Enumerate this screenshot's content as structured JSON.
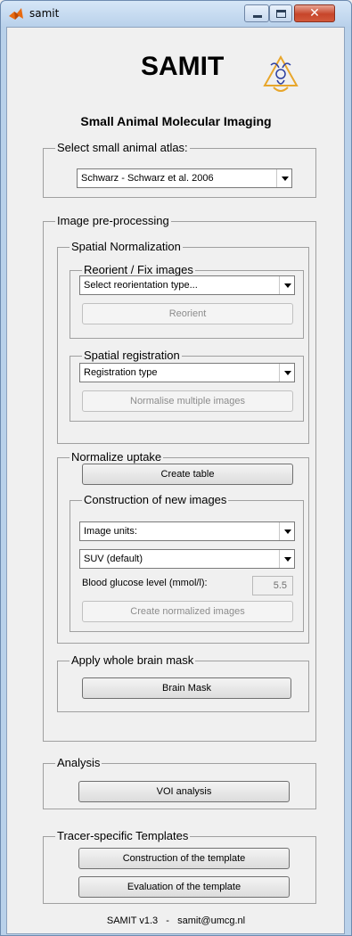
{
  "window": {
    "title": "samit"
  },
  "header": {
    "brand": "SAMIT",
    "subtitle": "Small Animal Molecular Imaging"
  },
  "atlas": {
    "legend": "Select small animal atlas:",
    "selected": "Schwarz - Schwarz et al. 2006"
  },
  "preprocessing": {
    "legend": "Image pre-processing",
    "spatial_normalization": {
      "legend": "Spatial Normalization",
      "reorient": {
        "legend": "Reorient / Fix images",
        "select_value": "Select reorientation type...",
        "button": "Reorient"
      },
      "registration": {
        "legend": "Spatial registration",
        "select_value": "Registration type",
        "button": "Normalise multiple images"
      }
    },
    "normalize_uptake": {
      "legend": "Normalize uptake",
      "create_table": "Create table",
      "construction": {
        "legend": "Construction of new images",
        "units_select": "Image units:",
        "suv_select": "SUV (default)",
        "glucose_label": "Blood glucose level (mmol/l):",
        "glucose_value": "5.5",
        "button": "Create normalized images"
      }
    },
    "brain_mask": {
      "legend": "Apply whole brain mask",
      "button": "Brain Mask"
    }
  },
  "analysis": {
    "legend": "Analysis",
    "button": "VOI analysis"
  },
  "templates": {
    "legend": "Tracer-specific Templates",
    "construct_button": "Construction of the template",
    "evaluate_button": "Evaluation of the template"
  },
  "footer": {
    "text": "SAMIT v1.3   -   samit@umcg.nl"
  },
  "colors": {
    "close_button": "#c7452a",
    "logo_primary": "#e8a62b",
    "logo_secondary": "#2d3fa0"
  },
  "icons": {
    "app": "matlab-icon",
    "logo": "radiation-logo"
  }
}
